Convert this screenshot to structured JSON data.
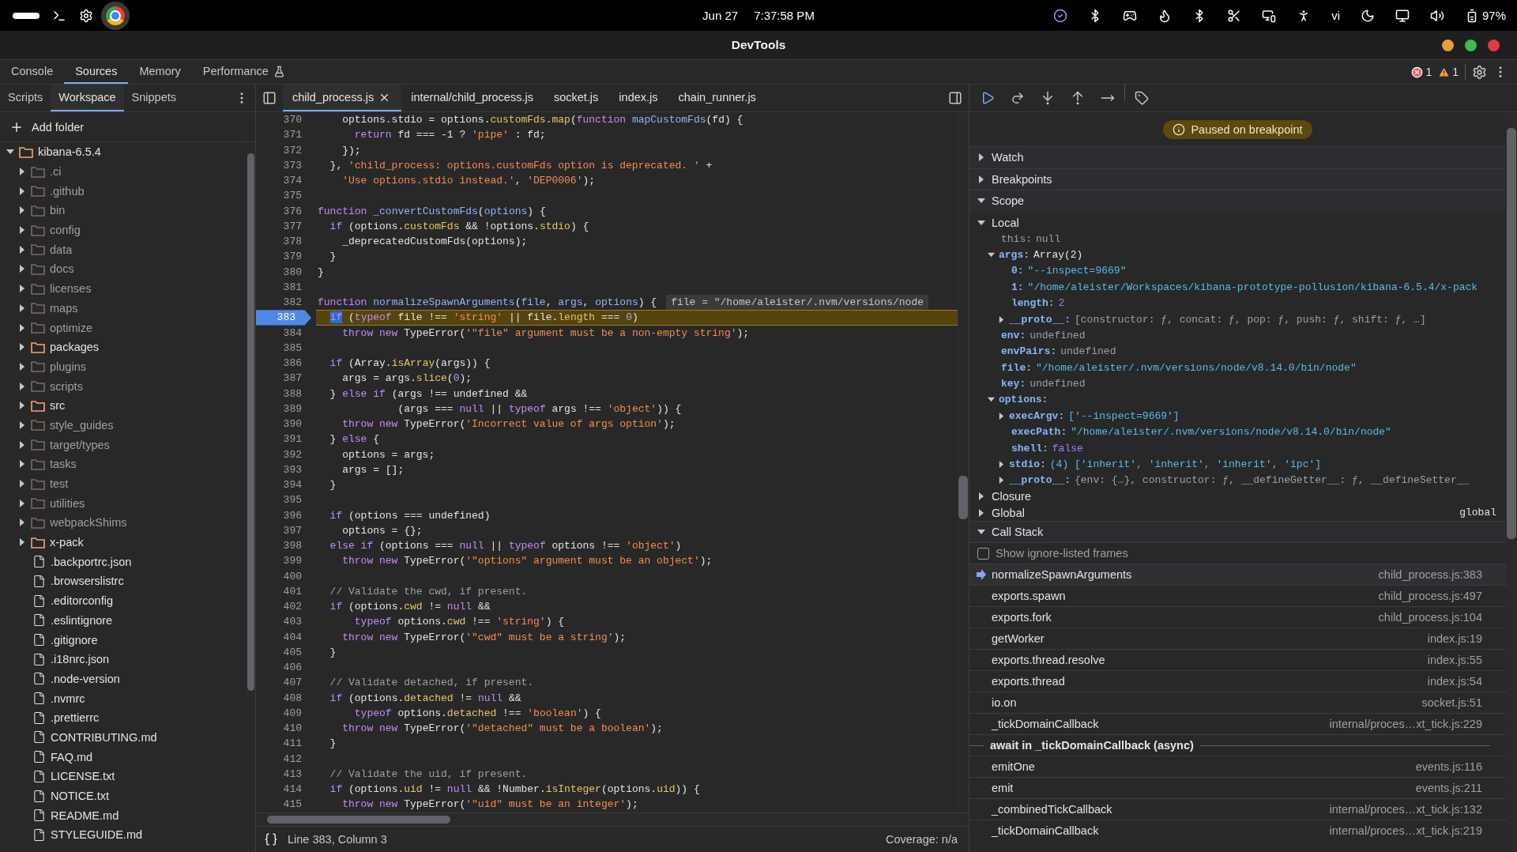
{
  "os_bar": {
    "date": "Jun 27",
    "time": "7:37:58 PM",
    "input_method": "vi",
    "battery": "97%"
  },
  "window": {
    "title": "DevTools"
  },
  "main_tabs": [
    {
      "label": "Console",
      "selected": false,
      "experimental": false
    },
    {
      "label": "Sources",
      "selected": true,
      "experimental": false
    },
    {
      "label": "Memory",
      "selected": false,
      "experimental": false
    },
    {
      "label": "Performance",
      "selected": false,
      "experimental": true
    }
  ],
  "issues": {
    "errors": "1",
    "warnings": "1"
  },
  "navigator": {
    "tabs": [
      {
        "label": "Scripts",
        "selected": false
      },
      {
        "label": "Workspace",
        "selected": true
      },
      {
        "label": "Snippets",
        "selected": false
      }
    ],
    "add_folder": "Add folder",
    "tree": [
      {
        "name": "kibana-6.5.4",
        "kind": "folder",
        "expanded": true,
        "highlighted": true,
        "children": [
          {
            "name": ".ci",
            "kind": "folder",
            "expanded": false,
            "highlighted": false
          },
          {
            "name": ".github",
            "kind": "folder",
            "expanded": false,
            "highlighted": false
          },
          {
            "name": "bin",
            "kind": "folder",
            "expanded": false,
            "highlighted": false
          },
          {
            "name": "config",
            "kind": "folder",
            "expanded": false,
            "highlighted": false
          },
          {
            "name": "data",
            "kind": "folder",
            "expanded": false,
            "highlighted": false
          },
          {
            "name": "docs",
            "kind": "folder",
            "expanded": false,
            "highlighted": false
          },
          {
            "name": "licenses",
            "kind": "folder",
            "expanded": false,
            "highlighted": false
          },
          {
            "name": "maps",
            "kind": "folder",
            "expanded": false,
            "highlighted": false
          },
          {
            "name": "optimize",
            "kind": "folder",
            "expanded": false,
            "highlighted": false
          },
          {
            "name": "packages",
            "kind": "folder",
            "expanded": false,
            "highlighted": true
          },
          {
            "name": "plugins",
            "kind": "folder",
            "expanded": false,
            "highlighted": false
          },
          {
            "name": "scripts",
            "kind": "folder",
            "expanded": false,
            "highlighted": false
          },
          {
            "name": "src",
            "kind": "folder",
            "expanded": false,
            "highlighted": true
          },
          {
            "name": "style_guides",
            "kind": "folder",
            "expanded": false,
            "highlighted": false
          },
          {
            "name": "target/types",
            "kind": "folder",
            "expanded": false,
            "highlighted": false
          },
          {
            "name": "tasks",
            "kind": "folder",
            "expanded": false,
            "highlighted": false
          },
          {
            "name": "test",
            "kind": "folder",
            "expanded": false,
            "highlighted": false
          },
          {
            "name": "utilities",
            "kind": "folder",
            "expanded": false,
            "highlighted": false
          },
          {
            "name": "webpackShims",
            "kind": "folder",
            "expanded": false,
            "highlighted": false
          },
          {
            "name": "x-pack",
            "kind": "folder",
            "expanded": false,
            "highlighted": true
          },
          {
            "name": ".backportrc.json",
            "kind": "file"
          },
          {
            "name": ".browserslistrc",
            "kind": "file"
          },
          {
            "name": ".editorconfig",
            "kind": "file"
          },
          {
            "name": ".eslintignore",
            "kind": "file"
          },
          {
            "name": ".gitignore",
            "kind": "file"
          },
          {
            "name": ".i18nrc.json",
            "kind": "file"
          },
          {
            "name": ".node-version",
            "kind": "file"
          },
          {
            "name": ".nvmrc",
            "kind": "file"
          },
          {
            "name": ".prettierrc",
            "kind": "file"
          },
          {
            "name": "CONTRIBUTING.md",
            "kind": "file"
          },
          {
            "name": "FAQ.md",
            "kind": "file"
          },
          {
            "name": "LICENSE.txt",
            "kind": "file"
          },
          {
            "name": "NOTICE.txt",
            "kind": "file"
          },
          {
            "name": "README.md",
            "kind": "file"
          },
          {
            "name": "STYLEGUIDE.md",
            "kind": "file"
          }
        ]
      }
    ]
  },
  "editor": {
    "tabs": [
      {
        "label": "child_process.js",
        "selected": true,
        "closable": true
      },
      {
        "label": "internal/child_process.js",
        "selected": false,
        "closable": false
      },
      {
        "label": "socket.js",
        "selected": false,
        "closable": false
      },
      {
        "label": "index.js",
        "selected": false,
        "closable": false
      },
      {
        "label": "chain_runner.js",
        "selected": false,
        "closable": false
      }
    ],
    "lines": [
      {
        "n": "370",
        "paused": false,
        "tokens": [
          {
            "kind": "plain",
            "text": "    options.stdio = options."
          },
          {
            "kind": "property",
            "text": "customFds"
          },
          {
            "kind": "plain",
            "text": "."
          },
          {
            "kind": "property",
            "text": "map"
          },
          {
            "kind": "plain",
            "text": "("
          },
          {
            "kind": "keyword",
            "text": "function"
          },
          {
            "kind": "definition",
            "text": " mapCustomFds"
          },
          {
            "kind": "plain",
            "text": "(fd) {"
          }
        ]
      },
      {
        "n": "371",
        "paused": false,
        "tokens": [
          {
            "kind": "keyword",
            "text": "      return"
          },
          {
            "kind": "plain",
            "text": " fd === -1 ? "
          },
          {
            "kind": "string",
            "text": "'pipe'"
          },
          {
            "kind": "plain",
            "text": " : fd;"
          }
        ]
      },
      {
        "n": "372",
        "paused": false,
        "tokens": [
          {
            "kind": "plain",
            "text": "    });"
          }
        ]
      },
      {
        "n": "373",
        "paused": false,
        "tokens": [
          {
            "kind": "plain",
            "text": "  }, "
          },
          {
            "kind": "string",
            "text": "'child_process: options.customFds option is deprecated. '"
          },
          {
            "kind": "plain",
            "text": " +"
          }
        ]
      },
      {
        "n": "374",
        "paused": false,
        "tokens": [
          {
            "kind": "string",
            "text": "    'Use options.stdio instead.'"
          },
          {
            "kind": "plain",
            "text": ", "
          },
          {
            "kind": "string",
            "text": "'DEP0006'"
          },
          {
            "kind": "plain",
            "text": ");"
          }
        ]
      },
      {
        "n": "375",
        "paused": false
      },
      {
        "n": "376",
        "paused": false,
        "tokens": [
          {
            "kind": "keyword",
            "text": "function"
          },
          {
            "kind": "definition",
            "text": " _convertCustomFds"
          },
          {
            "kind": "plain",
            "text": "("
          },
          {
            "kind": "definition",
            "text": "options"
          },
          {
            "kind": "plain",
            "text": ") {"
          }
        ]
      },
      {
        "n": "377",
        "paused": false,
        "tokens": [
          {
            "kind": "keyword",
            "text": "  if"
          },
          {
            "kind": "plain",
            "text": " (options."
          },
          {
            "kind": "property",
            "text": "customFds"
          },
          {
            "kind": "plain",
            "text": " && !options."
          },
          {
            "kind": "property",
            "text": "stdio"
          },
          {
            "kind": "plain",
            "text": ") {"
          }
        ]
      },
      {
        "n": "378",
        "paused": false,
        "tokens": [
          {
            "kind": "plain",
            "text": "    _deprecatedCustomFds(options);"
          }
        ]
      },
      {
        "n": "379",
        "paused": false,
        "tokens": [
          {
            "kind": "plain",
            "text": "  }"
          }
        ]
      },
      {
        "n": "380",
        "paused": false,
        "tokens": [
          {
            "kind": "plain",
            "text": "}"
          }
        ]
      },
      {
        "n": "381",
        "paused": false
      },
      {
        "n": "382",
        "paused": false,
        "tokens": [
          {
            "kind": "keyword",
            "text": "function"
          },
          {
            "kind": "definition",
            "text": " normalizeSpawnArguments"
          },
          {
            "kind": "plain",
            "text": "("
          },
          {
            "kind": "definition",
            "text": "file"
          },
          {
            "kind": "plain",
            "text": ", "
          },
          {
            "kind": "definition",
            "text": "args"
          },
          {
            "kind": "plain",
            "text": ", "
          },
          {
            "kind": "definition",
            "text": "options"
          },
          {
            "kind": "plain",
            "text": ") {"
          }
        ],
        "inline_value": "file = \"/home/aleister/.nvm/versions/node"
      },
      {
        "n": "383",
        "paused": true,
        "tokens": [
          {
            "kind": "cursor-keyword",
            "text": "  if"
          },
          {
            "kind": "plain",
            "text": " ("
          },
          {
            "kind": "keyword",
            "text": "typeof"
          },
          {
            "kind": "plain",
            "text": " file !== "
          },
          {
            "kind": "string",
            "text": "'string'"
          },
          {
            "kind": "plain",
            "text": " || file."
          },
          {
            "kind": "property",
            "text": "length"
          },
          {
            "kind": "plain",
            "text": " === "
          },
          {
            "kind": "number",
            "text": "0"
          },
          {
            "kind": "plain",
            "text": ")"
          }
        ]
      },
      {
        "n": "384",
        "paused": false,
        "tokens": [
          {
            "kind": "keyword",
            "text": "    throw new"
          },
          {
            "kind": "plain",
            "text": " TypeError("
          },
          {
            "kind": "string",
            "text": "'\"file\" argument must be a non-empty string'"
          },
          {
            "kind": "plain",
            "text": ");"
          }
        ]
      },
      {
        "n": "385",
        "paused": false
      },
      {
        "n": "386",
        "paused": false,
        "tokens": [
          {
            "kind": "keyword",
            "text": "  if"
          },
          {
            "kind": "plain",
            "text": " (Array."
          },
          {
            "kind": "property",
            "text": "isArray"
          },
          {
            "kind": "plain",
            "text": "(args)) {"
          }
        ]
      },
      {
        "n": "387",
        "paused": false,
        "tokens": [
          {
            "kind": "plain",
            "text": "    args = args."
          },
          {
            "kind": "property",
            "text": "slice"
          },
          {
            "kind": "plain",
            "text": "("
          },
          {
            "kind": "number",
            "text": "0"
          },
          {
            "kind": "plain",
            "text": ");"
          }
        ]
      },
      {
        "n": "388",
        "paused": false,
        "tokens": [
          {
            "kind": "plain",
            "text": "  } "
          },
          {
            "kind": "keyword",
            "text": "else if"
          },
          {
            "kind": "plain",
            "text": " (args !== undefined &&"
          }
        ]
      },
      {
        "n": "389",
        "paused": false,
        "tokens": [
          {
            "kind": "plain",
            "text": "             (args === "
          },
          {
            "kind": "keyword",
            "text": "null"
          },
          {
            "kind": "plain",
            "text": " || "
          },
          {
            "kind": "keyword",
            "text": "typeof"
          },
          {
            "kind": "plain",
            "text": " args !== "
          },
          {
            "kind": "string",
            "text": "'object'"
          },
          {
            "kind": "plain",
            "text": ")) {"
          }
        ]
      },
      {
        "n": "390",
        "paused": false,
        "tokens": [
          {
            "kind": "keyword",
            "text": "    throw new"
          },
          {
            "kind": "plain",
            "text": " TypeError("
          },
          {
            "kind": "string",
            "text": "'Incorrect value of args option'"
          },
          {
            "kind": "plain",
            "text": ");"
          }
        ]
      },
      {
        "n": "391",
        "paused": false,
        "tokens": [
          {
            "kind": "plain",
            "text": "  } "
          },
          {
            "kind": "keyword",
            "text": "else"
          },
          {
            "kind": "plain",
            "text": " {"
          }
        ]
      },
      {
        "n": "392",
        "paused": false,
        "tokens": [
          {
            "kind": "plain",
            "text": "    options = args;"
          }
        ]
      },
      {
        "n": "393",
        "paused": false,
        "tokens": [
          {
            "kind": "plain",
            "text": "    args = [];"
          }
        ]
      },
      {
        "n": "394",
        "paused": false,
        "tokens": [
          {
            "kind": "plain",
            "text": "  }"
          }
        ]
      },
      {
        "n": "395",
        "paused": false
      },
      {
        "n": "396",
        "paused": false,
        "tokens": [
          {
            "kind": "keyword",
            "text": "  if"
          },
          {
            "kind": "plain",
            "text": " (options === undefined)"
          }
        ]
      },
      {
        "n": "397",
        "paused": false,
        "tokens": [
          {
            "kind": "plain",
            "text": "    options = {};"
          }
        ]
      },
      {
        "n": "398",
        "paused": false,
        "tokens": [
          {
            "kind": "keyword",
            "text": "  else if"
          },
          {
            "kind": "plain",
            "text": " (options === "
          },
          {
            "kind": "keyword",
            "text": "null"
          },
          {
            "kind": "plain",
            "text": " || "
          },
          {
            "kind": "keyword",
            "text": "typeof"
          },
          {
            "kind": "plain",
            "text": " options !== "
          },
          {
            "kind": "string",
            "text": "'object'"
          },
          {
            "kind": "plain",
            "text": ")"
          }
        ]
      },
      {
        "n": "399",
        "paused": false,
        "tokens": [
          {
            "kind": "keyword",
            "text": "    throw new"
          },
          {
            "kind": "plain",
            "text": " TypeError("
          },
          {
            "kind": "string",
            "text": "'\"options\" argument must be an object'"
          },
          {
            "kind": "plain",
            "text": ");"
          }
        ]
      },
      {
        "n": "400",
        "paused": false
      },
      {
        "n": "401",
        "paused": false,
        "tokens": [
          {
            "kind": "comment",
            "text": "  // Validate the cwd, if present."
          }
        ]
      },
      {
        "n": "402",
        "paused": false,
        "tokens": [
          {
            "kind": "keyword",
            "text": "  if"
          },
          {
            "kind": "plain",
            "text": " (options."
          },
          {
            "kind": "property",
            "text": "cwd"
          },
          {
            "kind": "plain",
            "text": " != "
          },
          {
            "kind": "keyword",
            "text": "null"
          },
          {
            "kind": "plain",
            "text": " &&"
          }
        ]
      },
      {
        "n": "403",
        "paused": false,
        "tokens": [
          {
            "kind": "keyword",
            "text": "      typeof"
          },
          {
            "kind": "plain",
            "text": " options."
          },
          {
            "kind": "property",
            "text": "cwd"
          },
          {
            "kind": "plain",
            "text": " !== "
          },
          {
            "kind": "string",
            "text": "'string'"
          },
          {
            "kind": "plain",
            "text": ") {"
          }
        ]
      },
      {
        "n": "404",
        "paused": false,
        "tokens": [
          {
            "kind": "keyword",
            "text": "    throw new"
          },
          {
            "kind": "plain",
            "text": " TypeError("
          },
          {
            "kind": "string",
            "text": "'\"cwd\" must be a string'"
          },
          {
            "kind": "plain",
            "text": ");"
          }
        ]
      },
      {
        "n": "405",
        "paused": false,
        "tokens": [
          {
            "kind": "plain",
            "text": "  }"
          }
        ]
      },
      {
        "n": "406",
        "paused": false
      },
      {
        "n": "407",
        "paused": false,
        "tokens": [
          {
            "kind": "comment",
            "text": "  // Validate detached, if present."
          }
        ]
      },
      {
        "n": "408",
        "paused": false,
        "tokens": [
          {
            "kind": "keyword",
            "text": "  if"
          },
          {
            "kind": "plain",
            "text": " (options."
          },
          {
            "kind": "property",
            "text": "detached"
          },
          {
            "kind": "plain",
            "text": " != "
          },
          {
            "kind": "keyword",
            "text": "null"
          },
          {
            "kind": "plain",
            "text": " &&"
          }
        ]
      },
      {
        "n": "409",
        "paused": false,
        "tokens": [
          {
            "kind": "keyword",
            "text": "      typeof"
          },
          {
            "kind": "plain",
            "text": " options."
          },
          {
            "kind": "property",
            "text": "detached"
          },
          {
            "kind": "plain",
            "text": " !== "
          },
          {
            "kind": "string",
            "text": "'boolean'"
          },
          {
            "kind": "plain",
            "text": ") {"
          }
        ]
      },
      {
        "n": "410",
        "paused": false,
        "tokens": [
          {
            "kind": "keyword",
            "text": "    throw new"
          },
          {
            "kind": "plain",
            "text": " TypeError("
          },
          {
            "kind": "string",
            "text": "'\"detached\" must be a boolean'"
          },
          {
            "kind": "plain",
            "text": ");"
          }
        ]
      },
      {
        "n": "411",
        "paused": false,
        "tokens": [
          {
            "kind": "plain",
            "text": "  }"
          }
        ]
      },
      {
        "n": "412",
        "paused": false
      },
      {
        "n": "413",
        "paused": false,
        "tokens": [
          {
            "kind": "comment",
            "text": "  // Validate the uid, if present."
          }
        ]
      },
      {
        "n": "414",
        "paused": false,
        "tokens": [
          {
            "kind": "keyword",
            "text": "  if"
          },
          {
            "kind": "plain",
            "text": " (options."
          },
          {
            "kind": "property",
            "text": "uid"
          },
          {
            "kind": "plain",
            "text": " != "
          },
          {
            "kind": "keyword",
            "text": "null"
          },
          {
            "kind": "plain",
            "text": " && !Number."
          },
          {
            "kind": "property",
            "text": "isInteger"
          },
          {
            "kind": "plain",
            "text": "(options."
          },
          {
            "kind": "property",
            "text": "uid"
          },
          {
            "kind": "plain",
            "text": ")) {"
          }
        ]
      },
      {
        "n": "415",
        "paused": false,
        "tokens": [
          {
            "kind": "keyword",
            "text": "    throw new"
          },
          {
            "kind": "plain",
            "text": " TypeError("
          },
          {
            "kind": "string",
            "text": "'\"uid\" must be an integer'"
          },
          {
            "kind": "plain",
            "text": ");"
          }
        ]
      }
    ],
    "status": {
      "position": "Line 383, Column 3",
      "coverage": "Coverage: n/a"
    }
  },
  "debugger": {
    "banner": "Paused on breakpoint",
    "sections": [
      {
        "title": "Watch",
        "kind": "plain",
        "expanded": false
      },
      {
        "title": "Breakpoints",
        "kind": "plain",
        "expanded": false
      },
      {
        "title": "Scope",
        "kind": "scope",
        "expanded": true,
        "scopes": [
          {
            "name": "Local",
            "expanded": true,
            "entries": [
              {
                "key": "this:",
                "value": "null",
                "kind": "undef",
                "dimmed": true
              },
              {
                "key": "args:",
                "value": "Array(2)",
                "kind": "obj",
                "dimmed": false,
                "expanded": true,
                "children": [
                  {
                    "key": "0:",
                    "value": "\"--inspect=9669\"",
                    "kind": "str",
                    "dimmed": false
                  },
                  {
                    "key": "1:",
                    "value": "\"/home/aleister/Workspaces/kibana-prototype-pollusion/kibana-6.5.4/x-pack",
                    "kind": "str",
                    "dimmed": false
                  },
                  {
                    "key": "length:",
                    "value": "2",
                    "kind": "num",
                    "dimmed": false
                  },
                  {
                    "key": "__proto__:",
                    "value": "[constructor: ƒ, concat: ƒ, pop: ƒ, push: ƒ, shift: ƒ, …]",
                    "kind": "preview",
                    "dimmed": false,
                    "expanded": false
                  }
                ]
              },
              {
                "key": "env:",
                "value": "undefined",
                "kind": "undef",
                "dimmed": false
              },
              {
                "key": "envPairs:",
                "value": "undefined",
                "kind": "undef",
                "dimmed": false
              },
              {
                "key": "file:",
                "value": "\"/home/aleister/.nvm/versions/node/v8.14.0/bin/node\"",
                "kind": "str",
                "dimmed": false
              },
              {
                "key": "key:",
                "value": "undefined",
                "kind": "undef",
                "dimmed": false
              },
              {
                "key": "options:",
                "dimmed": false,
                "expanded": true,
                "children": [
                  {
                    "key": "execArgv:",
                    "value": "['--inspect=9669']",
                    "kind": "str",
                    "dimmed": false,
                    "expanded": false
                  },
                  {
                    "key": "execPath:",
                    "value": "\"/home/aleister/.nvm/versions/node/v8.14.0/bin/node\"",
                    "kind": "str",
                    "dimmed": false
                  },
                  {
                    "key": "shell:",
                    "value": "false",
                    "kind": "num",
                    "dimmed": false
                  },
                  {
                    "key": "stdio:",
                    "value": "(4) ['inherit', 'inherit', 'inherit', 'ipc']",
                    "kind": "str",
                    "dimmed": false,
                    "expanded": false
                  },
                  {
                    "key": "__proto__:",
                    "value": "{env: {…}, constructor: ƒ, __defineGetter__: ƒ, __defineSetter__",
                    "kind": "preview",
                    "dimmed": false,
                    "expanded": false
                  }
                ]
              }
            ]
          },
          {
            "name": "Closure",
            "expanded": false
          },
          {
            "name": "Global",
            "expanded": false,
            "value": "global"
          }
        ]
      },
      {
        "title": "Call Stack",
        "kind": "callstack",
        "expanded": true,
        "ignore_listed": {
          "label": "Show ignore-listed frames",
          "checked": false
        },
        "frames": [
          {
            "kind": "frame",
            "name": "normalizeSpawnArguments",
            "location": "child_process.js:383",
            "selected": true
          },
          {
            "kind": "frame",
            "name": "exports.spawn",
            "location": "child_process.js:497",
            "selected": false
          },
          {
            "kind": "frame",
            "name": "exports.fork",
            "location": "child_process.js:104",
            "selected": false
          },
          {
            "kind": "frame",
            "name": "getWorker",
            "location": "index.js:19",
            "selected": false
          },
          {
            "kind": "frame",
            "name": "exports.thread.resolve",
            "location": "index.js:55",
            "selected": false
          },
          {
            "kind": "frame",
            "name": "exports.thread",
            "location": "index.js:54",
            "selected": false
          },
          {
            "kind": "frame",
            "name": "io.on",
            "location": "socket.js:51",
            "selected": false
          },
          {
            "kind": "frame",
            "name": "_tickDomainCallback",
            "location": "internal/proces…xt_tick.js:229",
            "selected": false
          },
          {
            "kind": "async",
            "name": "await in _tickDomainCallback (async)"
          },
          {
            "kind": "frame",
            "name": "emitOne",
            "location": "events.js:116",
            "selected": false
          },
          {
            "kind": "frame",
            "name": "emit",
            "location": "events.js:211",
            "selected": false
          },
          {
            "kind": "frame",
            "name": "_combinedTickCallback",
            "location": "internal/proces…xt_tick.js:132",
            "selected": false
          },
          {
            "kind": "frame",
            "name": "_tickDomainCallback",
            "location": "internal/proces…xt_tick.js:219",
            "selected": false
          }
        ]
      }
    ]
  }
}
